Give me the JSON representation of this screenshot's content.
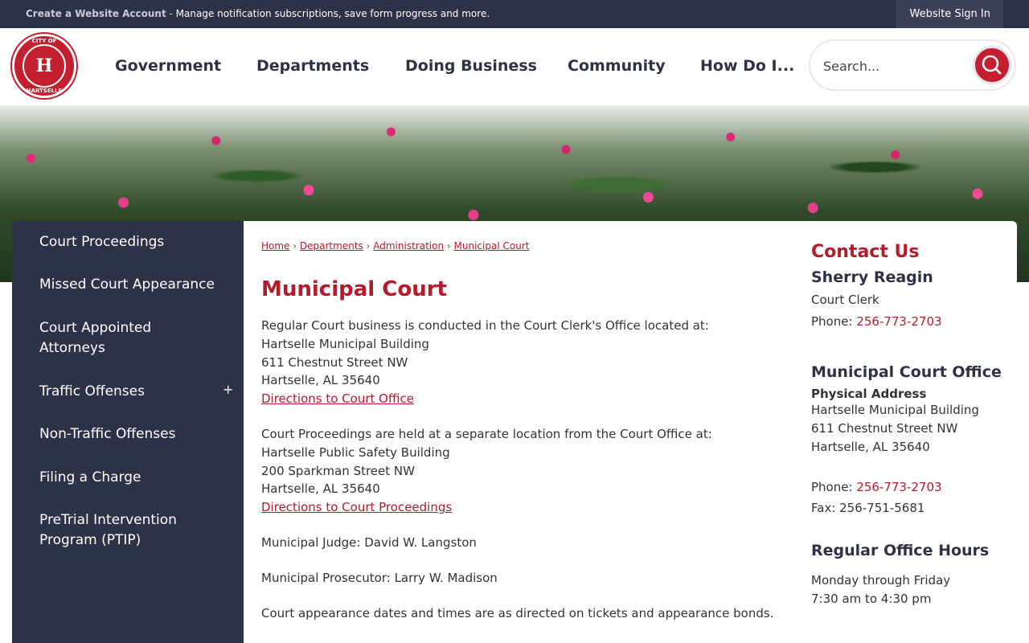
{
  "topbar": {
    "account_link": "Create a Website Account",
    "message": " - Manage notification subscriptions, save form progress and more.",
    "signin": "Website Sign In"
  },
  "logo": {
    "top_text": "CITY OF",
    "letter": "H",
    "bottom_text": "HARTSELLE"
  },
  "nav": [
    "Government",
    "Departments",
    "Doing Business",
    "Community",
    "How Do I..."
  ],
  "search": {
    "placeholder": "Search..."
  },
  "sidebar": {
    "items": [
      "Court Proceedings",
      "Missed Court Appearance",
      "Court Appointed Attorneys",
      "Traffic Offenses",
      "Non-Traffic Offenses",
      "Filing a Charge",
      "PreTrial Intervention Program (PTIP)"
    ],
    "expand_symbol": "+"
  },
  "breadcrumb": [
    "Home",
    "Departments",
    "Administration",
    "Municipal Court"
  ],
  "breadcrumb_separator": "›",
  "page": {
    "title": "Municipal Court",
    "office_intro": "Regular Court business is conducted in the Court Clerk's Office located at:",
    "office_lines": [
      "Hartselle Municipal Building",
      "611 Chestnut Street NW",
      "Hartselle, AL 35640"
    ],
    "office_link": "Directions to Court Office",
    "proc_intro": "Court Proceedings are held at a separate location from the Court Office at:",
    "proc_lines": [
      "Hartselle Public Safety Building",
      "200 Sparkman Street NW",
      "Hartselle, AL 35640"
    ],
    "proc_link": "Directions to Court Proceedings",
    "judge": "Municipal Judge: David W. Langston",
    "prosecutor": "Municipal Prosecutor: Larry W. Madison",
    "appearance": "Court appearance dates and times are as directed on tickets and appearance bonds."
  },
  "contact": {
    "title": "Contact Us",
    "name": "Sherry Reagin",
    "role": "Court Clerk",
    "phone_label": "Phone: ",
    "phone": "256-773-2703",
    "office_heading": "Municipal Court Office",
    "address_label": "Physical Address",
    "address_lines": [
      "Hartselle Municipal Building",
      "611 Chestnut Street NW",
      "Hartselle, AL 35640"
    ],
    "office_phone_label": "Phone: ",
    "office_phone": "256-773-2703",
    "fax": "Fax: 256-751-5681",
    "hours_heading": "Regular Office Hours",
    "hours_lines": [
      "Monday through Friday",
      "7:30 am to 4:30 pm"
    ]
  },
  "colors": {
    "brand_red": "#b41c2c",
    "navy": "#2e3248"
  }
}
